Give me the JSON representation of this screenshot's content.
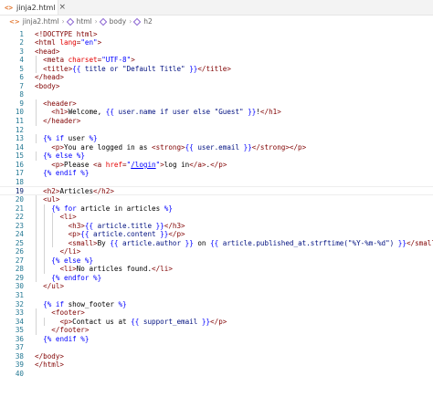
{
  "tab": {
    "icon": "html-file-icon",
    "title": "jinja2.html",
    "close": "×"
  },
  "breadcrumb": {
    "file": "jinja2.html",
    "items": [
      "html",
      "body",
      "h2"
    ]
  },
  "editor": {
    "active_line": 19,
    "lines": [
      [
        [
          "t-tag",
          "<!DOCTYPE html>"
        ]
      ],
      [
        [
          "t-tag",
          "<html "
        ],
        [
          "t-attr",
          "lang"
        ],
        [
          "t-tag",
          "="
        ],
        [
          "t-str",
          "\"en\""
        ],
        [
          "t-tag",
          ">"
        ]
      ],
      [
        [
          "t-tag",
          "<head>"
        ]
      ],
      [
        [
          "t-text",
          "  "
        ],
        [
          "t-tag",
          "<meta "
        ],
        [
          "t-attr",
          "charset"
        ],
        [
          "t-tag",
          "="
        ],
        [
          "t-str",
          "\"UTF-8\""
        ],
        [
          "t-tag",
          ">"
        ]
      ],
      [
        [
          "t-text",
          "  "
        ],
        [
          "t-tag",
          "<title>"
        ],
        [
          "t-delim",
          "{{ "
        ],
        [
          "t-var",
          "title or \"Default Title\""
        ],
        [
          "t-delim",
          " }}"
        ],
        [
          "t-tag",
          "</title>"
        ]
      ],
      [
        [
          "t-tag",
          "</head>"
        ]
      ],
      [
        [
          "t-tag",
          "<body>"
        ]
      ],
      [],
      [
        [
          "t-text",
          "  "
        ],
        [
          "t-tag",
          "<header>"
        ]
      ],
      [
        [
          "t-text",
          "    "
        ],
        [
          "t-tag",
          "<h1>"
        ],
        [
          "t-text",
          "Welcome, "
        ],
        [
          "t-delim",
          "{{ "
        ],
        [
          "t-var",
          "user.name if user else \"Guest\""
        ],
        [
          "t-delim",
          " }}"
        ],
        [
          "t-text",
          "!"
        ],
        [
          "t-tag",
          "</h1>"
        ]
      ],
      [
        [
          "t-text",
          "  "
        ],
        [
          "t-tag",
          "</header>"
        ]
      ],
      [],
      [
        [
          "t-text",
          "  "
        ],
        [
          "t-delim",
          "{% "
        ],
        [
          "t-kw",
          "if"
        ],
        [
          "t-text",
          " user "
        ],
        [
          "t-delim",
          "%}"
        ]
      ],
      [
        [
          "t-text",
          "    "
        ],
        [
          "t-tag",
          "<p>"
        ],
        [
          "t-text",
          "You are logged in as "
        ],
        [
          "t-tag",
          "<strong>"
        ],
        [
          "t-delim",
          "{{ "
        ],
        [
          "t-var",
          "user.email"
        ],
        [
          "t-delim",
          " }}"
        ],
        [
          "t-tag",
          "</strong></p>"
        ]
      ],
      [
        [
          "t-text",
          "  "
        ],
        [
          "t-delim",
          "{% "
        ],
        [
          "t-kw",
          "else"
        ],
        [
          "t-delim",
          " %}"
        ]
      ],
      [
        [
          "t-text",
          "    "
        ],
        [
          "t-tag",
          "<p>"
        ],
        [
          "t-text",
          "Please "
        ],
        [
          "t-tag",
          "<a "
        ],
        [
          "t-attr",
          "href"
        ],
        [
          "t-tag",
          "="
        ],
        [
          "t-str",
          "\""
        ],
        [
          "t-link",
          "/login"
        ],
        [
          "t-str",
          "\""
        ],
        [
          "t-tag",
          ">"
        ],
        [
          "t-text",
          "log in"
        ],
        [
          "t-tag",
          "</a>"
        ],
        [
          "t-text",
          "."
        ],
        [
          "t-tag",
          "</p>"
        ]
      ],
      [
        [
          "t-text",
          "  "
        ],
        [
          "t-delim",
          "{% "
        ],
        [
          "t-kw",
          "endif"
        ],
        [
          "t-delim",
          " %}"
        ]
      ],
      [],
      [
        [
          "t-text",
          "  "
        ],
        [
          "t-tag",
          "<h2>"
        ],
        [
          "t-text",
          "Articles"
        ],
        [
          "t-tag",
          "</h2>"
        ]
      ],
      [
        [
          "t-text",
          "  "
        ],
        [
          "t-tag",
          "<ul>"
        ]
      ],
      [
        [
          "t-text",
          "    "
        ],
        [
          "t-delim",
          "{% "
        ],
        [
          "t-kw",
          "for"
        ],
        [
          "t-text",
          " article in articles "
        ],
        [
          "t-delim",
          "%}"
        ]
      ],
      [
        [
          "t-text",
          "      "
        ],
        [
          "t-tag",
          "<li>"
        ]
      ],
      [
        [
          "t-text",
          "        "
        ],
        [
          "t-tag",
          "<h3>"
        ],
        [
          "t-delim",
          "{{ "
        ],
        [
          "t-var",
          "article.title"
        ],
        [
          "t-delim",
          " }}"
        ],
        [
          "t-tag",
          "</h3>"
        ]
      ],
      [
        [
          "t-text",
          "        "
        ],
        [
          "t-tag",
          "<p>"
        ],
        [
          "t-delim",
          "{{ "
        ],
        [
          "t-var",
          "article.content"
        ],
        [
          "t-delim",
          " }}"
        ],
        [
          "t-tag",
          "</p>"
        ]
      ],
      [
        [
          "t-text",
          "        "
        ],
        [
          "t-tag",
          "<small>"
        ],
        [
          "t-text",
          "By "
        ],
        [
          "t-delim",
          "{{ "
        ],
        [
          "t-var",
          "article.author"
        ],
        [
          "t-delim",
          " }}"
        ],
        [
          "t-text",
          " on "
        ],
        [
          "t-delim",
          "{{ "
        ],
        [
          "t-var",
          "article.published_at.strftime(\"%Y-%m-%d\")"
        ],
        [
          "t-delim",
          " }}"
        ],
        [
          "t-tag",
          "</small>"
        ]
      ],
      [
        [
          "t-text",
          "      "
        ],
        [
          "t-tag",
          "</li>"
        ]
      ],
      [
        [
          "t-text",
          "    "
        ],
        [
          "t-delim",
          "{% "
        ],
        [
          "t-kw",
          "else"
        ],
        [
          "t-delim",
          " %}"
        ]
      ],
      [
        [
          "t-text",
          "      "
        ],
        [
          "t-tag",
          "<li>"
        ],
        [
          "t-text",
          "No articles found."
        ],
        [
          "t-tag",
          "</li>"
        ]
      ],
      [
        [
          "t-text",
          "    "
        ],
        [
          "t-delim",
          "{% "
        ],
        [
          "t-kw",
          "endfor"
        ],
        [
          "t-delim",
          " %}"
        ]
      ],
      [
        [
          "t-text",
          "  "
        ],
        [
          "t-tag",
          "</ul>"
        ]
      ],
      [],
      [
        [
          "t-text",
          "  "
        ],
        [
          "t-delim",
          "{% "
        ],
        [
          "t-kw",
          "if"
        ],
        [
          "t-text",
          " show_footer "
        ],
        [
          "t-delim",
          "%}"
        ]
      ],
      [
        [
          "t-text",
          "    "
        ],
        [
          "t-tag",
          "<footer>"
        ]
      ],
      [
        [
          "t-text",
          "      "
        ],
        [
          "t-tag",
          "<p>"
        ],
        [
          "t-text",
          "Contact us at "
        ],
        [
          "t-delim",
          "{{ "
        ],
        [
          "t-var",
          "support_email"
        ],
        [
          "t-delim",
          " }}"
        ],
        [
          "t-tag",
          "</p>"
        ]
      ],
      [
        [
          "t-text",
          "    "
        ],
        [
          "t-tag",
          "</footer>"
        ]
      ],
      [
        [
          "t-text",
          "  "
        ],
        [
          "t-delim",
          "{% "
        ],
        [
          "t-kw",
          "endif"
        ],
        [
          "t-delim",
          " %}"
        ]
      ],
      [],
      [
        [
          "t-tag",
          "</body>"
        ]
      ],
      [
        [
          "t-tag",
          "</html>"
        ]
      ],
      []
    ]
  }
}
